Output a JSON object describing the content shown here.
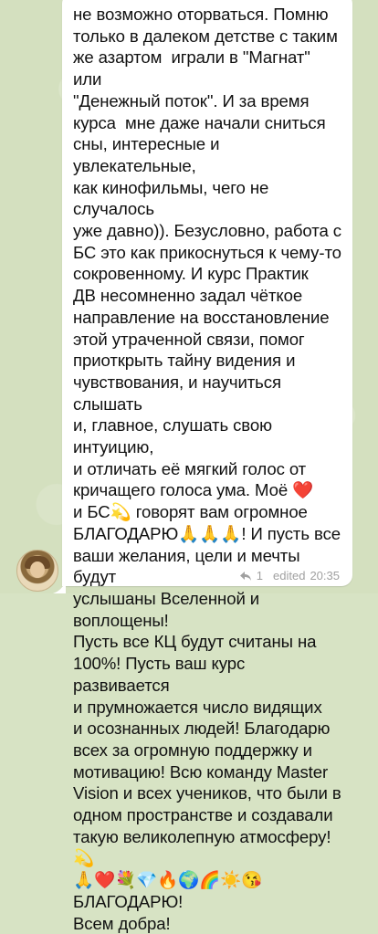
{
  "message": {
    "text": "не возможно оторваться. Помню\nтолько в далеком детстве с таким\nже азартом  играли в \"Магнат\" или\n\"Денежный поток\". И за время\nкурса  мне даже начали сниться\nсны, интересные и увлекательные,\nкак кинофильмы, чего не случалось\nуже давно)). Безусловно, работа с\nБС это как прикоснуться к чему-то\nсокровенному. И курс Практик\nДВ несомненно задал чёткое\nнаправление на восстановление\nэтой утраченной связи, помог\nприоткрыть тайну видения и\nчувствования, и научиться слышать\nи, главное, слушать свою интуицию,\nи отличать её мягкий голос от\nкричащего голоса ума. Моё ❤️\nи БС💫 говорят вам огромное\nБЛАГОДАРЮ🙏🙏🙏! И пусть все\nваши желания, цели и мечты будут\nуслышаны Вселенной и воплощены!\nПусть все КЦ будут считаны на\n100%! Пусть ваш курс развивается\nи прумножается число видящих\nи осознанных людей! Благодарю\nвсех за огромную поддержку и\nмотивацию! Всю команду Master\nVision и всех учеников, что были в\nодном пространстве и создавали\nтакую великолепную атмосферу!💫\n🙏❤️💐💎🔥🌍🌈☀️😘 БЛАГОДАРЮ!\nВсем добра!",
    "replies_count": "1",
    "edited_label": "edited",
    "time": "20:35",
    "reply_icon": "reply-arrow-icon"
  },
  "colors": {
    "wallpaper": "#d4e0bf",
    "bubble": "#ffffff",
    "meta": "#a0a0a0"
  }
}
